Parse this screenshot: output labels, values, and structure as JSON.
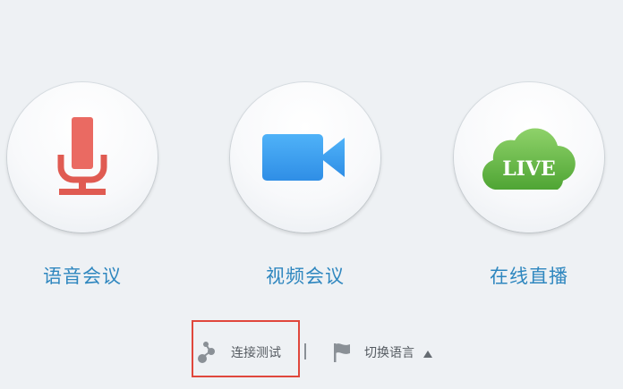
{
  "tiles": [
    {
      "label": "语音会议",
      "icon": "microphone-icon",
      "color": "#e8625a"
    },
    {
      "label": "视频会议",
      "icon": "video-camera-icon",
      "color": "#3b9cef"
    },
    {
      "label": "在线直播",
      "icon": "live-cloud-icon",
      "color": "#6ab845",
      "badge": "LIVE"
    }
  ],
  "footer": {
    "connection_test": "连接测试",
    "switch_language": "切换语言"
  },
  "colors": {
    "label": "#2f87bf",
    "highlight_border": "#e0473c",
    "background": "#eef1f4"
  }
}
